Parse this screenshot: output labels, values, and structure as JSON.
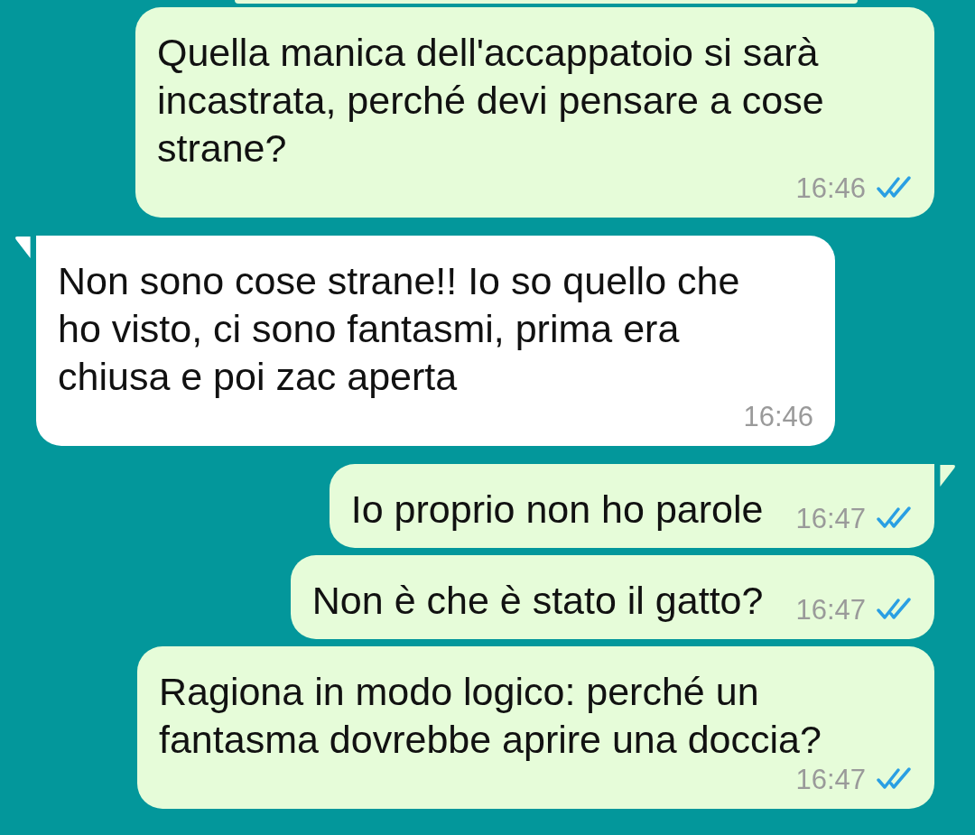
{
  "messages": [
    {
      "kind": "outgoing",
      "text": "Quella manica dell'accappatoio si sarà incastrata, perché devi pensare a cose strane?",
      "time": "16:46",
      "tail": false,
      "read": true
    },
    {
      "kind": "incoming",
      "text": "Non sono cose strane!! Io so quello che ho visto, ci sono fantasmi, prima era chiusa e poi zac aperta",
      "time": "16:46",
      "tail": true
    },
    {
      "kind": "outgoing",
      "text": "Io proprio non ho parole",
      "time": "16:47",
      "tail": true,
      "read": true
    },
    {
      "kind": "outgoing",
      "text": "Non è che è stato il gatto?",
      "time": "16:47",
      "tail": false,
      "read": true
    },
    {
      "kind": "outgoing",
      "text": "Ragiona in modo logico: perché un fantasma dovrebbe aprire una doccia?",
      "time": "16:47",
      "tail": false,
      "read": true
    }
  ]
}
